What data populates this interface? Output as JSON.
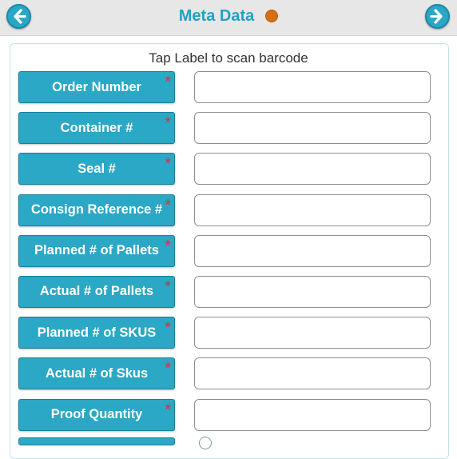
{
  "header": {
    "title": "Meta Data",
    "back_icon": "arrow-left-circle-icon",
    "forward_icon": "arrow-right-circle-icon",
    "status_color": "#d66e0f"
  },
  "hint": "Tap Label to scan barcode",
  "required_mark": "*",
  "fields": [
    {
      "label": "Order Number",
      "value": ""
    },
    {
      "label": "Container #",
      "value": ""
    },
    {
      "label": "Seal #",
      "value": ""
    },
    {
      "label": "Consign Reference #",
      "value": ""
    },
    {
      "label": "Planned # of Pallets",
      "value": ""
    },
    {
      "label": "Actual # of Pallets",
      "value": ""
    },
    {
      "label": "Planned # of SKUS",
      "value": ""
    },
    {
      "label": "Actual # of Skus",
      "value": ""
    },
    {
      "label": "Proof Quantity",
      "value": ""
    }
  ],
  "colors": {
    "accent": "#2aa8c5",
    "title": "#1fa3c3",
    "required": "#c93a3a"
  }
}
